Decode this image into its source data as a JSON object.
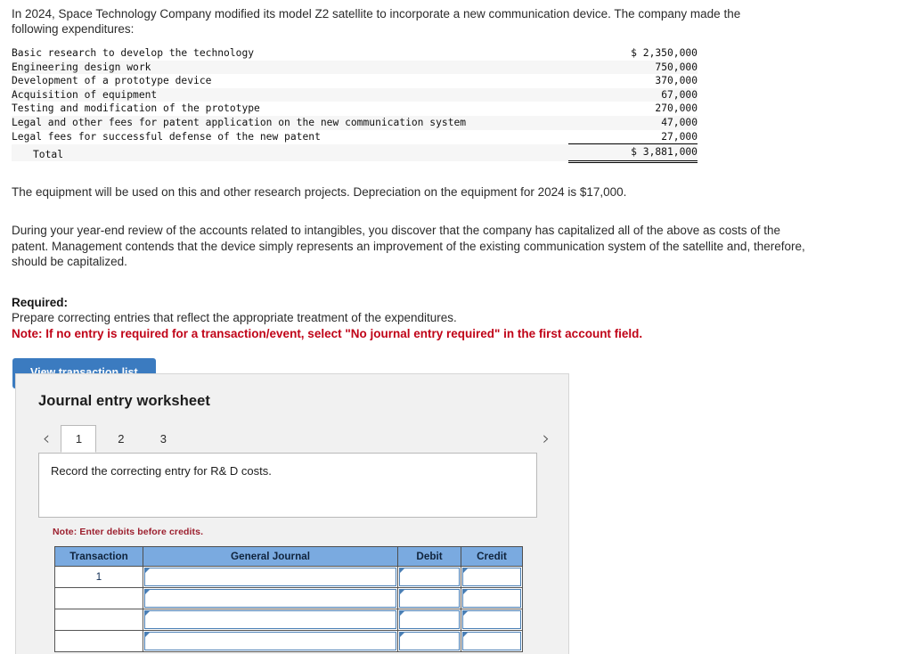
{
  "intro": {
    "paragraph": "In 2024, Space Technology Company modified its model Z2 satellite to incorporate a new communication device. The company made the following expenditures:"
  },
  "expenditures": {
    "rows": [
      {
        "label": "Basic research to develop the technology",
        "amount": "$ 2,350,000"
      },
      {
        "label": "Engineering design work",
        "amount": "750,000"
      },
      {
        "label": "Development of a prototype device",
        "amount": "370,000"
      },
      {
        "label": "Acquisition of equipment",
        "amount": "67,000"
      },
      {
        "label": "Testing and modification of the prototype",
        "amount": "270,000"
      },
      {
        "label": "Legal and other fees for patent application on the new communication system",
        "amount": "47,000"
      },
      {
        "label": "Legal fees for successful defense of the new patent",
        "amount": "27,000"
      }
    ],
    "total_label": "Total",
    "total_amount": "$ 3,881,000"
  },
  "body": {
    "equipment_note": "The equipment will be used on this and other research projects. Depreciation on the equipment for 2024 is $17,000.",
    "review_note": "During your year-end review of the accounts related to intangibles, you discover that the company has capitalized all of the above as costs of the patent. Management contends that the device simply represents an improvement of the existing communication system of the satellite and, therefore, should be capitalized."
  },
  "required": {
    "heading": "Required:",
    "instruction": "Prepare correcting entries that reflect the appropriate treatment of the expenditures.",
    "note": "Note: If no entry is required for a transaction/event, select \"No journal entry required\" in the first account field."
  },
  "toolbar": {
    "view_transaction_list": "View transaction list"
  },
  "worksheet": {
    "title": "Journal entry worksheet",
    "prev_arrow": "‹",
    "next_arrow": "›",
    "tabs": [
      {
        "label": "1",
        "active": true
      },
      {
        "label": "2",
        "active": false
      },
      {
        "label": "3",
        "active": false
      }
    ],
    "prompt": "Record the correcting entry for R& D costs.",
    "note_debits": "Note: Enter debits before credits.",
    "table": {
      "headers": [
        "Transaction",
        "General Journal",
        "Debit",
        "Credit"
      ],
      "rows": [
        {
          "transaction": "1",
          "general_journal": "",
          "debit": "",
          "credit": ""
        },
        {
          "transaction": "",
          "general_journal": "",
          "debit": "",
          "credit": ""
        },
        {
          "transaction": "",
          "general_journal": "",
          "debit": "",
          "credit": ""
        },
        {
          "transaction": "",
          "general_journal": "",
          "debit": "",
          "credit": ""
        }
      ]
    }
  },
  "colors": {
    "button_blue": "#3b7bc0",
    "header_blue": "#7aaae0",
    "input_border_blue": "#4a7fb5",
    "note_red": "#c00418",
    "debits_note_red": "#9c1f2e",
    "panel_bg": "#f1f1f1"
  }
}
